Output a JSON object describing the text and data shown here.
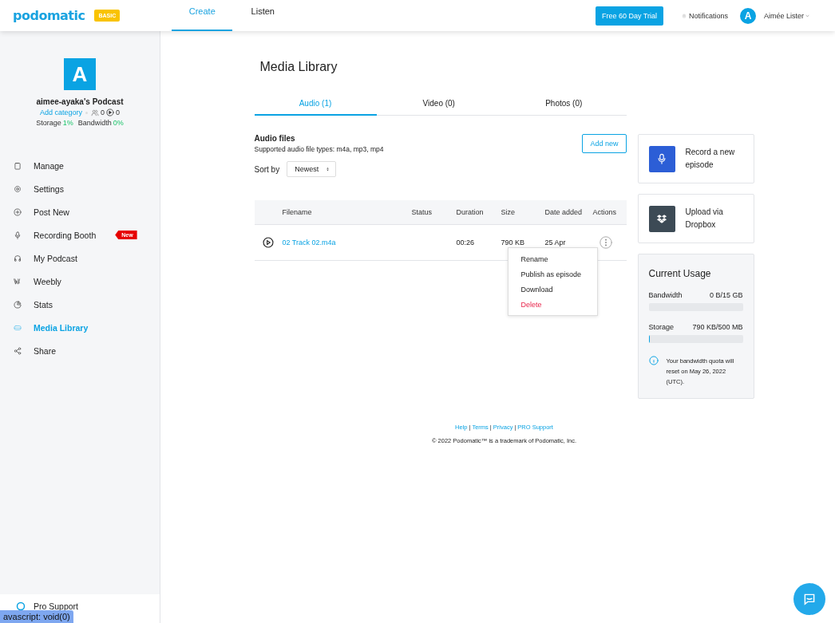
{
  "header": {
    "logo": "podomatic",
    "plan_badge": "BASIC",
    "nav": [
      {
        "label": "Create",
        "selected": true
      },
      {
        "label": "Listen",
        "selected": false
      }
    ],
    "trial_button": "Free 60 Day Trial",
    "notifications": "Notifications",
    "avatar_letter": "A",
    "user_name": "Aimée Lister"
  },
  "sidebar": {
    "avatar_letter": "A",
    "podcast_name": "aimee-ayaka's Podcast",
    "add_category": "Add category",
    "followers": "0",
    "plays": "0",
    "storage_label": "Storage",
    "storage_value": "1%",
    "bandwidth_label": "Bandwidth",
    "bandwidth_value": "0%",
    "items": [
      {
        "label": "Manage",
        "selected": false
      },
      {
        "label": "Settings",
        "selected": false
      },
      {
        "label": "Post New",
        "selected": false
      },
      {
        "label": "Recording Booth",
        "selected": false,
        "badge": "New"
      },
      {
        "label": "My Podcast",
        "selected": false
      },
      {
        "label": "Weebly",
        "selected": false
      },
      {
        "label": "Stats",
        "selected": false
      },
      {
        "label": "Media Library",
        "selected": true
      },
      {
        "label": "Share",
        "selected": false
      }
    ],
    "bottom_item": "Pro Support"
  },
  "main": {
    "title": "Media Library",
    "tabs": [
      {
        "label": "Audio (1)",
        "selected": true
      },
      {
        "label": "Video (0)",
        "selected": false
      },
      {
        "label": "Photos (0)",
        "selected": false
      }
    ],
    "section_title": "Audio files",
    "section_note": "Supported audio file types: m4a, mp3, mp4",
    "add_button": "Add new",
    "sort_label": "Sort by",
    "sort_value": "Newest",
    "table": {
      "columns": [
        "",
        "Filename",
        "Status",
        "Duration",
        "Size",
        "Date added",
        "Actions"
      ],
      "rows": [
        {
          "filename": "02 Track 02.m4a",
          "status": "",
          "duration": "00:26",
          "size": "790 KB",
          "date_added": "25 Apr"
        }
      ]
    },
    "action_menu": [
      {
        "label": "Rename",
        "kind": "normal"
      },
      {
        "label": "Publish as episode",
        "kind": "normal"
      },
      {
        "label": "Download",
        "kind": "normal"
      },
      {
        "label": "Delete",
        "kind": "danger"
      }
    ]
  },
  "side_panel": {
    "actions": [
      {
        "label": "Record a new episode"
      },
      {
        "label": "Upload via Dropbox"
      }
    ],
    "usage": {
      "title": "Current Usage",
      "meters": [
        {
          "label": "Bandwidth",
          "reading": "0 B/15 GB",
          "level": 0
        },
        {
          "label": "Storage",
          "reading": "790 KB/500 MB",
          "level": 0.002
        }
      ],
      "note": "Your bandwidth quota will reset on May 26, 2022 (UTC)."
    }
  },
  "footer": {
    "links": [
      "Help",
      "Terms",
      "Privacy",
      "PRO Support"
    ],
    "separator": "|",
    "copyright": "© 2022 Podomatic™ is a trademark of Podomatic, Inc."
  },
  "status_tooltip": "avascript: void(0)"
}
